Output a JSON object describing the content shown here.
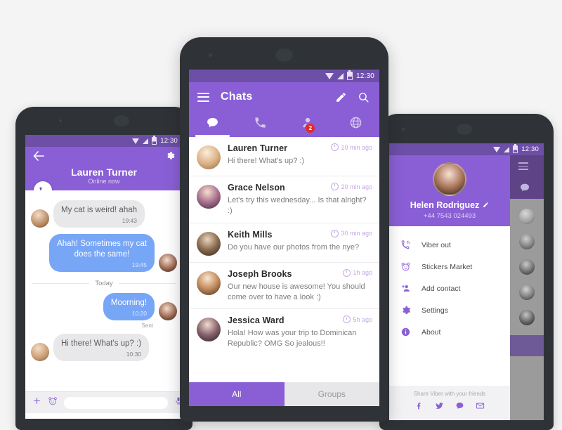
{
  "background_color": "#f4f4f4",
  "colors": {
    "primary_purple": "#8a5fd6",
    "status_bar_purple": "#6d4fa8",
    "badge_red": "#e02b2b",
    "outgoing_bubble_blue": "#77a6f7",
    "incoming_bubble_grey": "#e8e8ea",
    "phone_frame": "#2f3337"
  },
  "left_phone": {
    "status_bar": {
      "time": "12:30",
      "icons": [
        "wifi-icon",
        "signal-icon",
        "battery-icon"
      ]
    },
    "header": {
      "back_icon": "back-arrow-icon",
      "settings_icon": "gear-icon",
      "contact_name": "Lauren Turner",
      "presence": "Online now",
      "call_fab_icon": "phone-icon"
    },
    "messages": [
      {
        "direction": "in",
        "text": "My cat is weird! ahah",
        "time": "19:43"
      },
      {
        "direction": "out",
        "text": "Ahah! Sometimes my cat does the same!",
        "time": "19:45"
      }
    ],
    "day_separator": "Today",
    "messages2": [
      {
        "direction": "out",
        "text": "Moorning!",
        "time": "10:20",
        "status": "Sent"
      },
      {
        "direction": "in",
        "text": "Hi there! What's up? :)",
        "time": "10:30"
      }
    ],
    "sent_label": "Sent",
    "input_bar": {
      "plus_icon": "plus-icon",
      "sticker_icon": "sticker-bear-icon",
      "placeholder": "",
      "mic_icon": "microphone-icon"
    }
  },
  "center_phone": {
    "status_bar": {
      "time": "12:30"
    },
    "app_bar": {
      "menu_icon": "hamburger-menu-icon",
      "title": "Chats",
      "compose_icon": "pencil-icon",
      "search_icon": "search-icon"
    },
    "tabs": [
      {
        "name": "chats-tab",
        "icon": "chat-bubble-icon",
        "active": true,
        "badge": null
      },
      {
        "name": "calls-tab",
        "icon": "phone-icon",
        "active": false,
        "badge": null
      },
      {
        "name": "contacts-tab",
        "icon": "person-icon",
        "active": false,
        "badge": "2"
      },
      {
        "name": "public-tab",
        "icon": "globe-icon",
        "active": false,
        "badge": null
      }
    ],
    "chat_list": [
      {
        "name": "Lauren Turner",
        "time": "10 min ago",
        "message": "Hi there! What's up? :)"
      },
      {
        "name": "Grace Nelson",
        "time": "20 min ago",
        "message": "Let's try this wednesday... Is that alright? :)"
      },
      {
        "name": "Keith Mills",
        "time": "30 min ago",
        "message": "Do you have our photos from the nye?"
      },
      {
        "name": "Joseph Brooks",
        "time": "1h ago",
        "message": "Our new house is awesome! You should come over to have a look :)"
      },
      {
        "name": "Jessica Ward",
        "time": "5h ago",
        "message": "Hola! How was your trip to Dominican Republic? OMG So jealous!!"
      }
    ],
    "bottom_tabs": [
      {
        "label": "All",
        "active": true
      },
      {
        "label": "Groups",
        "active": false
      }
    ]
  },
  "right_phone": {
    "status_bar": {
      "time": "12:30"
    },
    "profile": {
      "name": "Helen Rodriguez",
      "edit_icon": "pencil-icon",
      "phone_number": "+44 7543 024493"
    },
    "menu_items": [
      {
        "icon": "viber-out-phone-icon",
        "label": "Viber out"
      },
      {
        "icon": "sticker-bear-icon",
        "label": "Stickers Market"
      },
      {
        "icon": "add-person-icon",
        "label": "Add contact"
      },
      {
        "icon": "gear-icon",
        "label": "Settings"
      },
      {
        "icon": "info-icon",
        "label": "About"
      }
    ],
    "footer": {
      "text": "Share Viber with your friends",
      "socials": [
        "facebook-icon",
        "twitter-icon",
        "chat-bubble-icon",
        "email-icon"
      ]
    },
    "behind_menu_icon": "hamburger-menu-icon"
  }
}
